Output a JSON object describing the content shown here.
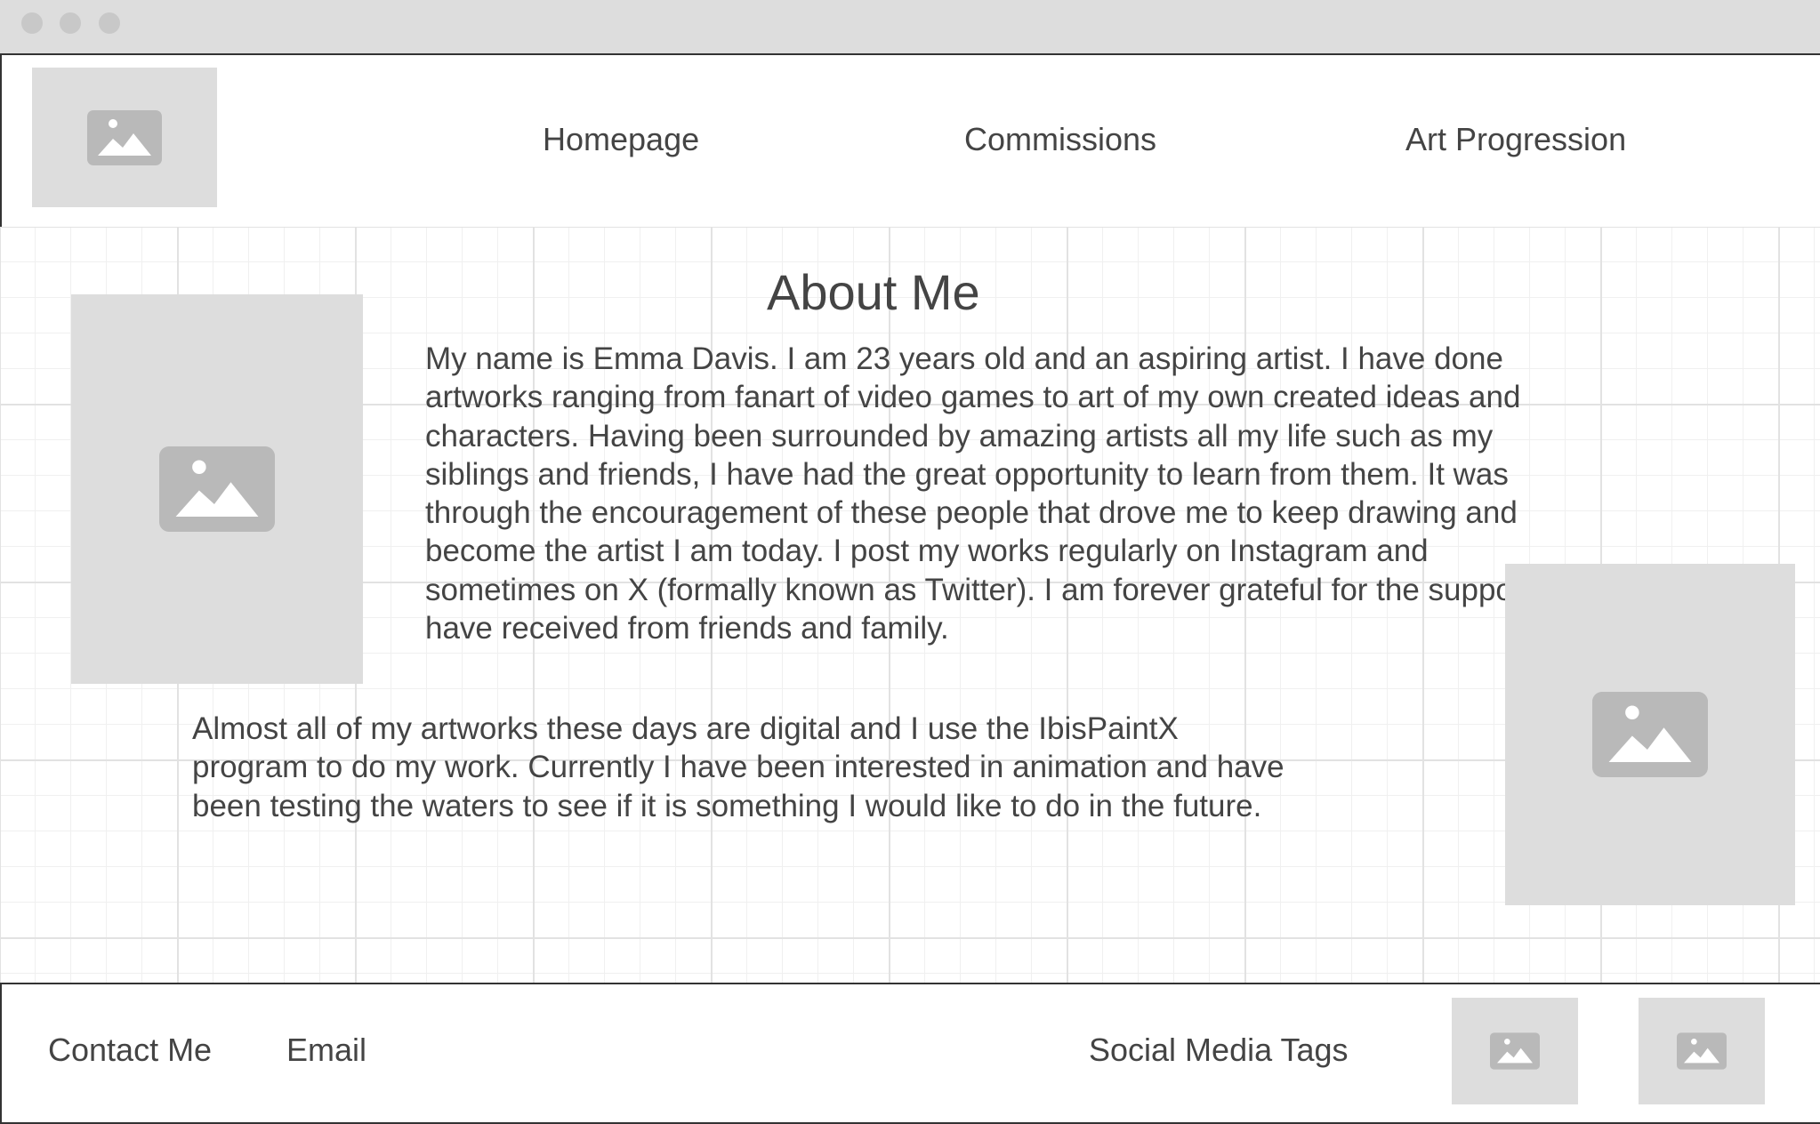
{
  "window": {
    "controls": [
      "close",
      "minimize",
      "maximize"
    ]
  },
  "header": {
    "logo_icon": "image-placeholder-icon",
    "nav": [
      {
        "label": "Homepage"
      },
      {
        "label": "Commissions"
      },
      {
        "label": "Art Progression"
      }
    ]
  },
  "main": {
    "title": "About Me",
    "paragraph_1": "My name is Emma Davis. I am 23 years old and an aspiring artist. I have done artworks ranging from fanart of video games to art of my own created ideas and characters. Having been surrounded by amazing artists all my life such as my siblings and friends, I have had the great opportunity to learn from them. It was through the encouragement of these people that drove me to keep drawing and become the artist I am today. I post my works regularly on Instagram and sometimes on X (formally known as Twitter). I am forever grateful for the support I have received from friends and family.",
    "paragraph_2": "Almost all of my artworks these days are digital and I use the IbisPaintX program to do my work. Currently I have been interested in animation and have been testing the waters to see if it is something I would like to do in the future."
  },
  "footer": {
    "contact_label": "Contact Me",
    "email_label": "Email",
    "social_label": "Social Media Tags"
  },
  "colors": {
    "placeholder": "#dddddd",
    "placeholder_icon": "#b9b9b9",
    "text": "#444444",
    "border": "#333333"
  }
}
